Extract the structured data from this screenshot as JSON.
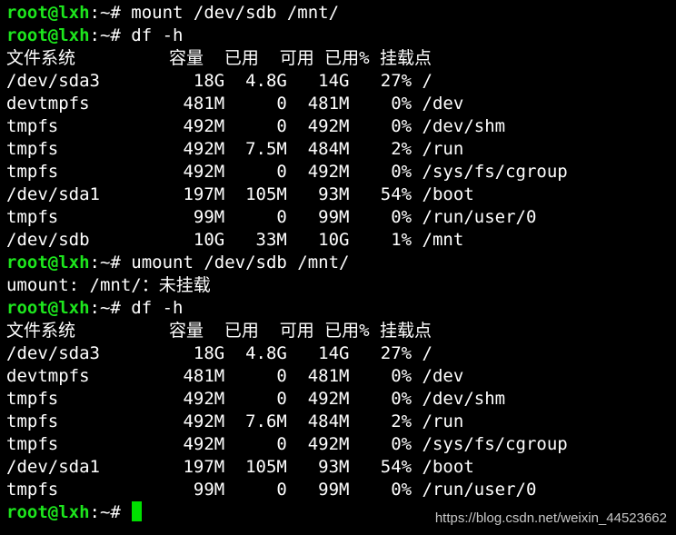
{
  "terminal": {
    "prompt_color": "#1de51d",
    "text_color": "#ffffff",
    "background": "#000000",
    "cursor_color": "#00e000",
    "lines": [
      {
        "type": "prompt",
        "prompt": "root@lxh",
        "suffix": ":~# ",
        "command": "mount /dev/sdb /mnt/"
      },
      {
        "type": "prompt",
        "prompt": "root@lxh",
        "suffix": ":~# ",
        "command": "df -h"
      },
      {
        "type": "output",
        "text": "文件系统         容量  已用  可用 已用% 挂载点"
      },
      {
        "type": "output",
        "text": "/dev/sda3         18G  4.8G   14G   27% /"
      },
      {
        "type": "output",
        "text": "devtmpfs         481M     0  481M    0% /dev"
      },
      {
        "type": "output",
        "text": "tmpfs            492M     0  492M    0% /dev/shm"
      },
      {
        "type": "output",
        "text": "tmpfs            492M  7.5M  484M    2% /run"
      },
      {
        "type": "output",
        "text": "tmpfs            492M     0  492M    0% /sys/fs/cgroup"
      },
      {
        "type": "output",
        "text": "/dev/sda1        197M  105M   93M   54% /boot"
      },
      {
        "type": "output",
        "text": "tmpfs             99M     0   99M    0% /run/user/0"
      },
      {
        "type": "output",
        "text": "/dev/sdb          10G   33M   10G    1% /mnt"
      },
      {
        "type": "prompt",
        "prompt": "root@lxh",
        "suffix": ":~# ",
        "command": "umount /dev/sdb /mnt/"
      },
      {
        "type": "output",
        "text": "umount: /mnt/：未挂载"
      },
      {
        "type": "prompt",
        "prompt": "root@lxh",
        "suffix": ":~# ",
        "command": "df -h"
      },
      {
        "type": "output",
        "text": "文件系统         容量  已用  可用 已用% 挂载点"
      },
      {
        "type": "output",
        "text": "/dev/sda3         18G  4.8G   14G   27% /"
      },
      {
        "type": "output",
        "text": "devtmpfs         481M     0  481M    0% /dev"
      },
      {
        "type": "output",
        "text": "tmpfs            492M     0  492M    0% /dev/shm"
      },
      {
        "type": "output",
        "text": "tmpfs            492M  7.6M  484M    2% /run"
      },
      {
        "type": "output",
        "text": "tmpfs            492M     0  492M    0% /sys/fs/cgroup"
      },
      {
        "type": "output",
        "text": "/dev/sda1        197M  105M   93M   54% /boot"
      },
      {
        "type": "output",
        "text": "tmpfs             99M     0   99M    0% /run/user/0"
      },
      {
        "type": "prompt",
        "prompt": "root@lxh",
        "suffix": ":~# ",
        "command": "",
        "cursor": true
      }
    ]
  },
  "watermark": {
    "text": "https://blog.csdn.net/weixin_44523662"
  }
}
